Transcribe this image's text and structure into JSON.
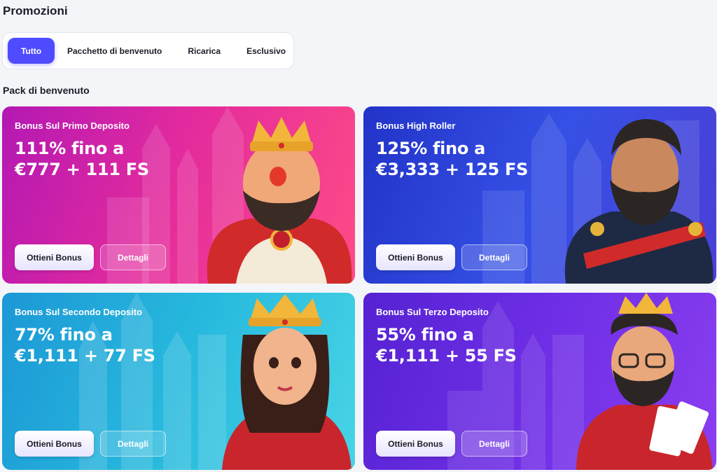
{
  "page": {
    "title": "Promozioni"
  },
  "filters": {
    "tabs": [
      {
        "label": "Tutto",
        "active": true
      },
      {
        "label": "Pacchetto di benvenuto",
        "active": false
      },
      {
        "label": "Ricarica",
        "active": false
      },
      {
        "label": "Esclusivo",
        "active": false
      }
    ]
  },
  "section": {
    "title": "Pack di benvenuto"
  },
  "cards": [
    {
      "label": "Bonus Sul Primo Deposito",
      "amount_line1": "111% fino a",
      "amount_line2": "€777 + 111 FS",
      "get_label": "Ottieni Bonus",
      "details_label": "Dettagli",
      "colors": [
        "#c81fa8",
        "#ff3f8e"
      ],
      "character": "king-character"
    },
    {
      "label": "Bonus High Roller",
      "amount_line1": "125% fino a",
      "amount_line2": "€3,333 + 125 FS",
      "get_label": "Ottieni Bonus",
      "details_label": "Dettagli",
      "colors": [
        "#2a3ad0",
        "#4b6cf0"
      ],
      "character": "general-character"
    },
    {
      "label": "Bonus Sul Secondo Deposito",
      "amount_line1": "77% fino a",
      "amount_line2": "€1,111 + 77 FS",
      "get_label": "Ottieni Bonus",
      "details_label": "Dettagli",
      "colors": [
        "#1aa7d8",
        "#45d6e6"
      ],
      "character": "queen-character"
    },
    {
      "label": "Bonus Sul Terzo Deposito",
      "amount_line1": "55% fino a",
      "amount_line2": "€1,111 + 55 FS",
      "get_label": "Ottieni Bonus",
      "details_label": "Dettagli",
      "colors": [
        "#5a22d6",
        "#8a3ff0"
      ],
      "character": "card-king-character"
    }
  ]
}
